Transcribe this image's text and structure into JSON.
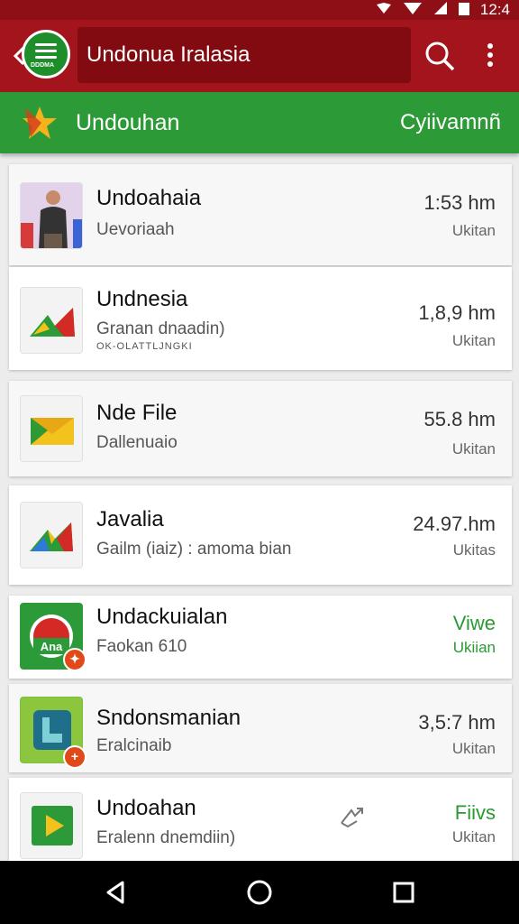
{
  "status_bar": {
    "time": "12:4"
  },
  "app_bar": {
    "logo_tag": "DDDMA",
    "search_text": "Undonua Iralasia"
  },
  "sub_bar": {
    "left": "Undouhan",
    "right": "Cyiivamnñ"
  },
  "items": [
    {
      "title": "Undoahaia",
      "subtitle": "Uevoriaah",
      "meta": "1:53 hm",
      "place": "Ukitan"
    },
    {
      "title": "Undnesia",
      "subtitle": "Granan dnaadin)",
      "subtitle2": "OK-OLATTLJNGKI",
      "meta": "1,8,9 hm",
      "place": "Ukitan"
    },
    {
      "title": "Nde File",
      "subtitle": "Dallenuaio",
      "meta": "55.8 hm",
      "place": "Ukitan"
    },
    {
      "title": "Javalia",
      "subtitle": "Gailm (iaiz) : amoma bian",
      "meta": "24.97.hm",
      "place": "Ukitas"
    },
    {
      "title": "Undackuialan",
      "subtitle": "Faokan 610",
      "meta": "Viwe",
      "place": "Ukiian",
      "thumb_text": "Ana"
    },
    {
      "title": "Sndonsmanian",
      "subtitle": "Eralcinaib",
      "meta": "3,5:7 hm",
      "place": "Ukitan"
    },
    {
      "title": "Undoahan",
      "subtitle": "Eralenn dnemdiin)",
      "meta": "Fiivs",
      "place": "Ukitan"
    }
  ],
  "colors": {
    "primary": "#a3141c",
    "green": "#2d9a38",
    "accent_orange": "#e04a1a"
  }
}
